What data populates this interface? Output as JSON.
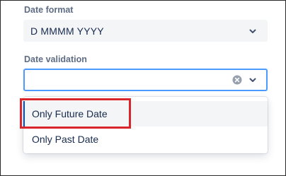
{
  "date_format": {
    "label": "Date format",
    "value": "D MMMM YYYY",
    "chevron_icon": "chevron-down-icon"
  },
  "date_validation": {
    "label": "Date validation",
    "value": "",
    "clear_icon": "clear-circle-icon",
    "chevron_icon": "chevron-down-icon",
    "focus_color": "#4c9aff"
  },
  "menu": {
    "options": [
      {
        "label": "Only Future Date",
        "highlighted": true
      },
      {
        "label": "Only Past Date",
        "highlighted": false
      }
    ],
    "accent_color": "#0052cc"
  },
  "annotation": {
    "color": "#d9262c",
    "target": "Only Future Date"
  }
}
